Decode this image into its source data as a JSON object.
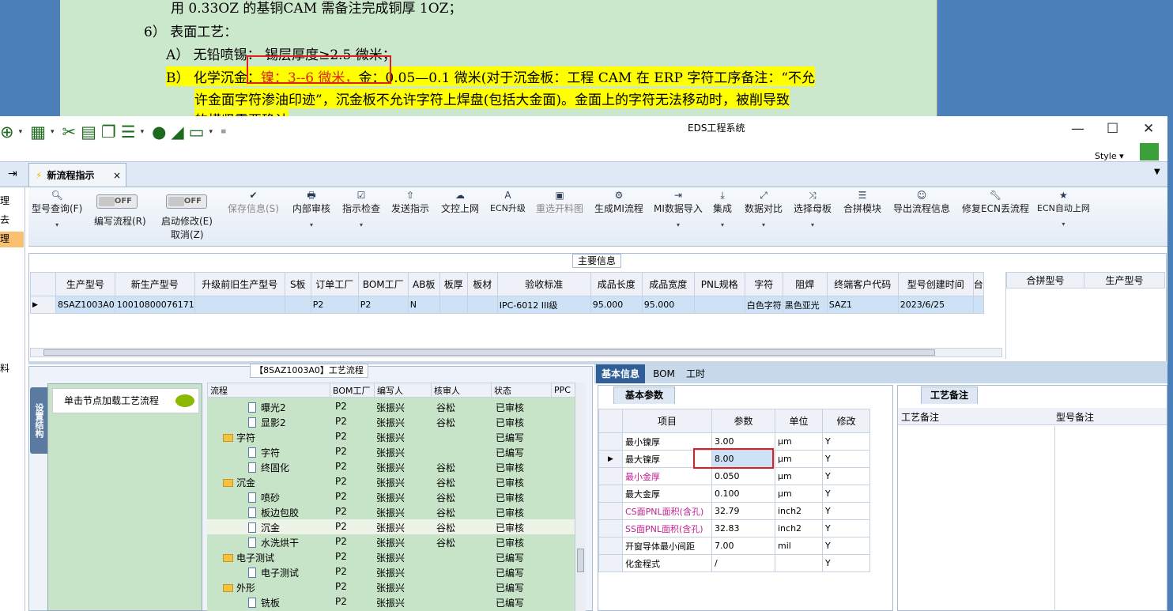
{
  "background_doc": {
    "line1": "用 0.33OZ 的基铜CAM 需备注完成铜厚 1OZ；",
    "line2": "6） 表面工艺：",
    "line3": "A） 无铅喷锡： 锡层厚度≥2.5 微米；",
    "line4a": "B） 化学沉金：",
    "line4b": "镍：3--6 微米，",
    "line4c": "金：0.05—0.1 微米(对于沉金板：工程 CAM 在 ERP 字符工序备注：“不允",
    "line5": "许金面字符渗油印迹”，沉金板不允许字符上焊盘(包括大金面)。金面上的字符无法移动时，被削导致",
    "line6": "的横竖需要确认"
  },
  "window": {
    "title": "EDS工程系统",
    "style_label": "Style",
    "controls": {
      "minimize": "—",
      "maximize": "☐",
      "close": "✕"
    }
  },
  "left_strip": {
    "items": [
      "理",
      "去",
      "理",
      "料"
    ]
  },
  "tab": {
    "label": "新流程指示",
    "close": "×"
  },
  "ribbon": {
    "query": "型号查询(F)",
    "write_flow": "编写流程(R)",
    "write_toggle": "OFF",
    "start_modify": "启动修改(E)",
    "cancel_modify": "取消(Z)",
    "start_toggle": "OFF",
    "save": "保存信息(S)",
    "internal_audit": "内部审核",
    "indicator_check": "指示检查",
    "send_indicator": "发送指示",
    "upload": "文控上网",
    "ecn_upgrade": "ECN升级",
    "reselect": "重选开料图",
    "gen_mi": "生成MI流程",
    "mi_import": "MI数据导入",
    "integrate": "集成",
    "compare": "数据对比",
    "select_mother": "选择母板",
    "merge_module": "合拼模块",
    "export_flow": "导出流程信息",
    "repair_ecn": "修复ECN丢流程",
    "ecn_auto": "ECN自动上网"
  },
  "main_info": {
    "title": "主要信息",
    "columns": [
      "生产型号",
      "新生产型号",
      "升级前旧生产型号",
      "S板",
      "订单工厂",
      "BOM工厂",
      "AB板",
      "板厚",
      "板材",
      "验收标准",
      "成品长度",
      "成品宽度",
      "PNL规格",
      "字符",
      "阻焊",
      "终端客户代码",
      "型号创建时间",
      "台"
    ],
    "row": [
      "8SAZ1003A0",
      "10010800076171",
      "",
      "",
      "P2",
      "P2",
      "N",
      "",
      "",
      "IPC-6012 III级",
      "95.000",
      "95.000",
      "",
      "白色字符",
      "黑色亚光",
      "SAZ1",
      "2023/6/25",
      ""
    ],
    "right_columns": [
      "合拼型号",
      "生产型号"
    ]
  },
  "process": {
    "title": "【8SAZ1003A0】工艺流程",
    "vertical_tab": "设置结构",
    "node_hint": "单击节点加载工艺流程",
    "columns": [
      "流程",
      "BOM工厂",
      "编写人",
      "核审人",
      "状态",
      "PPC"
    ],
    "rows": [
      {
        "name": "曝光2",
        "kind": "doc",
        "bom": "P2",
        "writer": "张振兴",
        "reviewer": "谷松",
        "status": "已审核"
      },
      {
        "name": "显影2",
        "kind": "doc",
        "bom": "P2",
        "writer": "张振兴",
        "reviewer": "谷松",
        "status": "已审核"
      },
      {
        "name": "字符",
        "kind": "folder",
        "bom": "P2",
        "writer": "张振兴",
        "reviewer": "",
        "status": "已编写"
      },
      {
        "name": "字符",
        "kind": "doc",
        "bom": "P2",
        "writer": "张振兴",
        "reviewer": "",
        "status": "已编写"
      },
      {
        "name": "终固化",
        "kind": "doc",
        "bom": "P2",
        "writer": "张振兴",
        "reviewer": "谷松",
        "status": "已审核"
      },
      {
        "name": "沉金",
        "kind": "folder",
        "bom": "P2",
        "writer": "张振兴",
        "reviewer": "谷松",
        "status": "已审核"
      },
      {
        "name": "喷砂",
        "kind": "doc",
        "bom": "P2",
        "writer": "张振兴",
        "reviewer": "谷松",
        "status": "已审核"
      },
      {
        "name": "板边包胶",
        "kind": "doc",
        "bom": "P2",
        "writer": "张振兴",
        "reviewer": "谷松",
        "status": "已审核"
      },
      {
        "name": "沉金",
        "kind": "doc",
        "bom": "P2",
        "writer": "张振兴",
        "reviewer": "谷松",
        "status": "已审核"
      },
      {
        "name": "水洗烘干",
        "kind": "doc",
        "bom": "P2",
        "writer": "张振兴",
        "reviewer": "谷松",
        "status": "已审核"
      },
      {
        "name": "电子测试",
        "kind": "folder",
        "bom": "P2",
        "writer": "张振兴",
        "reviewer": "",
        "status": "已编写"
      },
      {
        "name": "电子测试",
        "kind": "doc",
        "bom": "P2",
        "writer": "张振兴",
        "reviewer": "",
        "status": "已编写"
      },
      {
        "name": "外形",
        "kind": "folder",
        "bom": "P2",
        "writer": "张振兴",
        "reviewer": "",
        "status": "已编写"
      },
      {
        "name": "铣板",
        "kind": "doc",
        "bom": "P2",
        "writer": "张振兴",
        "reviewer": "",
        "status": "已编写"
      }
    ]
  },
  "info_tabs": [
    "基本信息",
    "BOM",
    "工时"
  ],
  "basic_params": {
    "title": "基本参数",
    "columns": [
      "项目",
      "参数",
      "单位",
      "修改"
    ],
    "rows": [
      {
        "item": "最小镍厚",
        "value": "3.00",
        "unit": "μm",
        "mod": "Y",
        "highlight": false
      },
      {
        "item": "最大镍厚",
        "value": "8.00",
        "unit": "μm",
        "mod": "Y",
        "highlight": false
      },
      {
        "item": "最小金厚",
        "value": "0.050",
        "unit": "μm",
        "mod": "Y",
        "highlight": true
      },
      {
        "item": "最大金厚",
        "value": "0.100",
        "unit": "μm",
        "mod": "Y",
        "highlight": false
      },
      {
        "item": "CS面PNL面积(含孔)",
        "value": "32.79",
        "unit": "inch2",
        "mod": "Y",
        "highlight": true
      },
      {
        "item": "SS面PNL面积(含孔)",
        "value": "32.83",
        "unit": "inch2",
        "mod": "Y",
        "highlight": true
      },
      {
        "item": "开窗导体最小间距",
        "value": "7.00",
        "unit": "mil",
        "mod": "Y",
        "highlight": false
      },
      {
        "item": "化金程式",
        "value": "/",
        "unit": "",
        "mod": "Y",
        "highlight": false
      }
    ]
  },
  "notes": {
    "title": "工艺备注",
    "col1": "工艺备注",
    "col2": "型号备注"
  }
}
